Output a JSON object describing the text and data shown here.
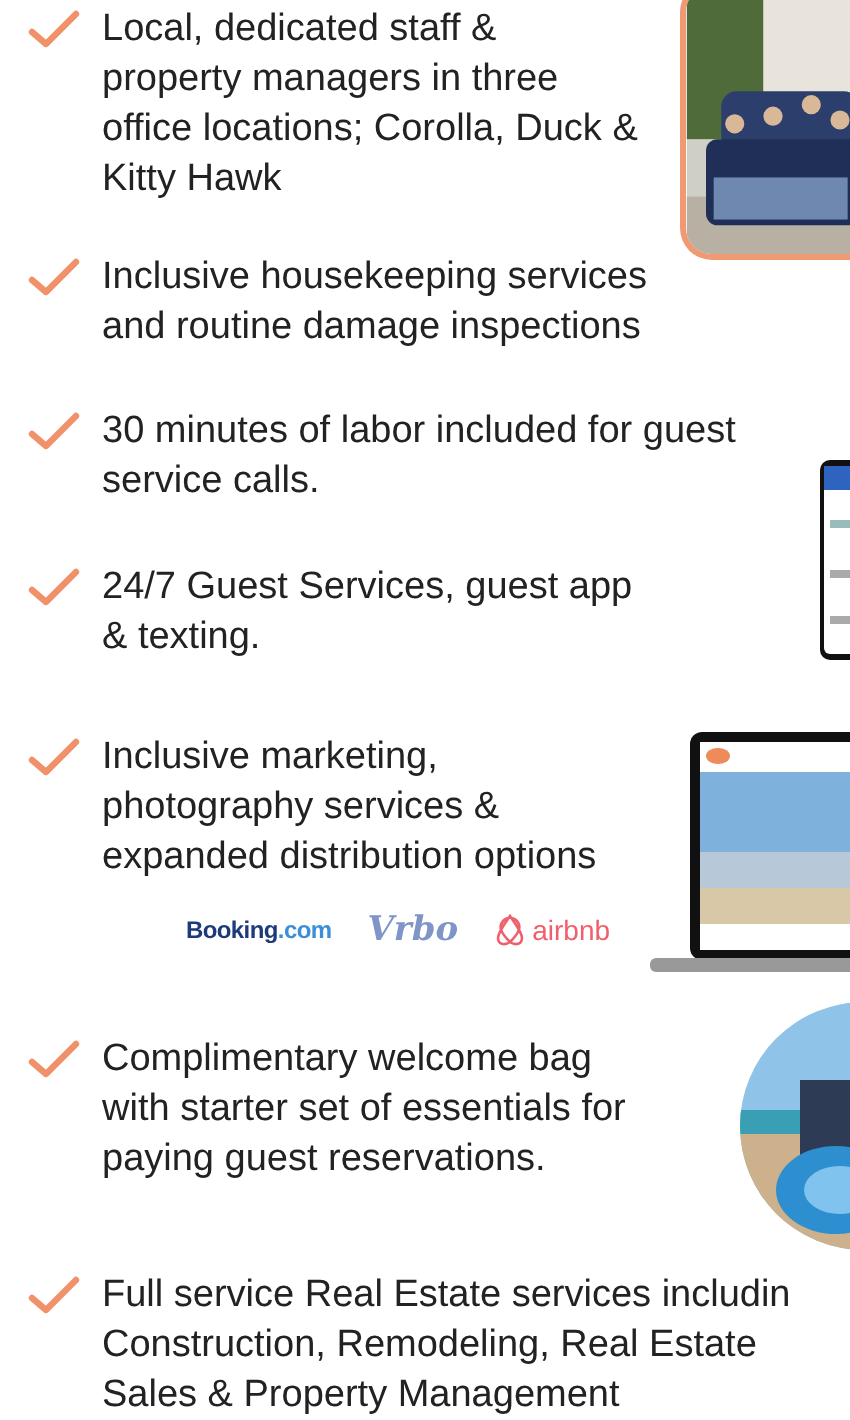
{
  "features": [
    {
      "lines": [
        "Local, dedicated staff &",
        "property managers in three",
        "office locations; Corolla, Duck &",
        "Kitty Hawk"
      ],
      "media": {
        "kind": "picture"
      }
    },
    {
      "lines": [
        "Inclusive housekeeping services",
        "and routine damage inspections"
      ]
    },
    {
      "lines": [
        "30 minutes of labor included for guest",
        "service calls."
      ],
      "media": {
        "kind": "picture"
      }
    },
    {
      "lines": [
        "24/7 Guest Services, guest app",
        "& texting."
      ]
    },
    {
      "lines": [
        "Inclusive marketing,",
        "photography services &",
        "expanded distribution options"
      ],
      "media": {
        "kind": "picture"
      },
      "logos": [
        {
          "kind": "booking",
          "name": "Booking",
          "suffix": ".com"
        },
        {
          "kind": "vrbo",
          "name": "Vrbo"
        },
        {
          "kind": "airbnb",
          "name": "airbnb"
        }
      ]
    },
    {
      "lines": [
        "Complimentary welcome bag",
        "with starter set of essentials for",
        "paying guest reservations."
      ],
      "media": {
        "kind": "picture"
      }
    },
    {
      "lines": [
        "Full service Real Estate services includin",
        "Construction, Remodeling, Real Estate",
        "Sales & Property Management"
      ]
    }
  ]
}
